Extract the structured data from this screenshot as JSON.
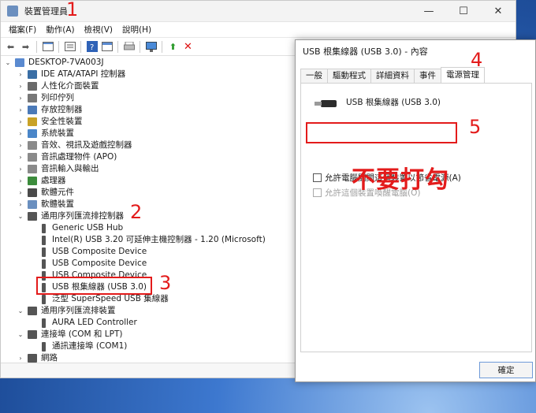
{
  "main_window": {
    "title": "裝置管理員",
    "controls": {
      "minimize": "—",
      "maximize": "☐",
      "close": "✕"
    },
    "menu": [
      "檔案(F)",
      "動作(A)",
      "檢視(V)",
      "說明(H)"
    ]
  },
  "tree": {
    "root": "DESKTOP-7VA003J",
    "items": [
      {
        "label": "IDE ATA/ATAPI 控制器",
        "expander": "›",
        "icon_color": "#3a6ea5"
      },
      {
        "label": "人性化介面裝置",
        "expander": "›",
        "icon_color": "#6a6a6a"
      },
      {
        "label": "列印佇列",
        "expander": "›",
        "icon_color": "#777777"
      },
      {
        "label": "存放控制器",
        "expander": "›",
        "icon_color": "#4b7ab8"
      },
      {
        "label": "安全性裝置",
        "expander": "›",
        "icon_color": "#c9a227"
      },
      {
        "label": "系統裝置",
        "expander": "›",
        "icon_color": "#4a86c8"
      },
      {
        "label": "音效、視訊及遊戲控制器",
        "expander": "›",
        "icon_color": "#8a8a8a"
      },
      {
        "label": "音訊處理物件 (APO)",
        "expander": "›",
        "icon_color": "#8a8a8a"
      },
      {
        "label": "音訊輸入與輸出",
        "expander": "›",
        "icon_color": "#8a8a8a"
      },
      {
        "label": "處理器",
        "expander": "›",
        "icon_color": "#3c8c3c"
      },
      {
        "label": "軟體元件",
        "expander": "›",
        "icon_color": "#4a4a4a"
      },
      {
        "label": "軟體裝置",
        "expander": "›",
        "icon_color": "#6a8fbf"
      },
      {
        "label": "通用序列匯流排控制器",
        "expander": "⌄",
        "icon_color": "#555555"
      },
      {
        "label": "Generic USB Hub",
        "expander": "",
        "icon_color": "#555555",
        "child": true
      },
      {
        "label": "Intel(R) USB 3.20 可延伸主機控制器 - 1.20 (Microsoft)",
        "expander": "",
        "icon_color": "#555555",
        "child": true
      },
      {
        "label": "USB Composite Device",
        "expander": "",
        "icon_color": "#555555",
        "child": true
      },
      {
        "label": "USB Composite Device",
        "expander": "",
        "icon_color": "#555555",
        "child": true
      },
      {
        "label": "USB Composite Device",
        "expander": "",
        "icon_color": "#555555",
        "child": true
      },
      {
        "label": "USB 根集線器 (USB 3.0)",
        "expander": "",
        "icon_color": "#555555",
        "child": true
      },
      {
        "label": "泛型 SuperSpeed USB 集線器",
        "expander": "",
        "icon_color": "#555555",
        "child": true
      },
      {
        "label": "通用序列匯流排裝置",
        "expander": "⌄",
        "icon_color": "#555555"
      },
      {
        "label": "AURA LED Controller",
        "expander": "",
        "icon_color": "#555555",
        "child": true
      },
      {
        "label": "連接埠 (COM 和 LPT)",
        "expander": "⌄",
        "icon_color": "#555555"
      },
      {
        "label": "通訊連接埠 (COM1)",
        "expander": "",
        "icon_color": "#555555",
        "child": true
      },
      {
        "label": "網路",
        "expander": "›",
        "icon_color": "#555555"
      }
    ]
  },
  "dialog": {
    "title": "USB 根集線器 (USB 3.0) - 內容",
    "tabs": [
      "一般",
      "驅動程式",
      "詳細資料",
      "事件",
      "電源管理"
    ],
    "active_tab": "電源管理",
    "device_name": "USB 根集線器 (USB 3.0)",
    "option_allow_off": "允許電腦關閉這個裝置以節省電源(A)",
    "option_allow_wake": "允許這個裝置喚醒電腦(O)",
    "ok_button": "確定"
  },
  "annotations": {
    "n1": "1",
    "n2": "2",
    "n3": "3",
    "n4": "4",
    "n5": "5",
    "note": "不要打勾"
  },
  "colors": {
    "annotation_red": "#e31b1b",
    "accent_blue": "#6e9ad8"
  }
}
